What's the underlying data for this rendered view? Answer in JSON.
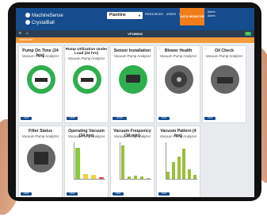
{
  "header": {
    "brand_primary": "MachineSense",
    "brand_secondary": "CrystalBall",
    "site_select": "Plantline",
    "nav": [
      "RESOURCES",
      "USERS",
      "MACHINES"
    ],
    "data_button": "DATA MONITOR",
    "user_line1": "Admin",
    "user_line2": "Admin"
  },
  "toolbar": {
    "title": "VP280843",
    "badge": "ON",
    "breadcrumb": "Dashboard"
  },
  "cards": [
    {
      "title": "Pump On Time (24 hrs)",
      "subtitle": "Vacuum Pump Analyzer",
      "button": "VIEW MORE"
    },
    {
      "title": "Pump Utilization Under Load (24 hrs)",
      "subtitle": "Vacuum Pump Analyzer",
      "button": "VIEW MORE"
    },
    {
      "title": "Sensor Installation",
      "subtitle": "Vacuum Pump Analyzer",
      "button": "MORE DETAILS"
    },
    {
      "title": "Blower Health",
      "subtitle": "Vacuum Pump Analyzer",
      "button": "VIEW MORE"
    },
    {
      "title": "Oil Check",
      "subtitle": "Vacuum Pump Analyzer",
      "button": "VIEW MORE"
    },
    {
      "title": "Filter Status",
      "subtitle": "Vacuum Pump Analyzer",
      "button": "VIEW MORE"
    },
    {
      "title": "Operating Vacuum (24 hrs)",
      "subtitle": "Vacuum Pump Analyzer",
      "button": "VIEW MORE"
    },
    {
      "title": "Vacuum Frequency (10 min)",
      "subtitle": "Vacuum Pump Analyzer",
      "button": "VIEW MORE"
    },
    {
      "title": "Vacuum Pattern (4 hrs)",
      "subtitle": "Vacuum Pump Analyzer",
      "button": "VIEW MORE"
    }
  ],
  "colors": {
    "header": "#154c8e",
    "accent_orange": "#f07d1a",
    "status_green": "#2fae4e",
    "chart_green": "#8dc63f",
    "chart_yellow": "#f4d03f",
    "chart_red": "#e74c3c",
    "chart_olive": "#9bbf3a"
  },
  "icons": [
    "machinesense-logo-icon",
    "menu-icon",
    "home-icon",
    "gauge-icon",
    "sensor-icon",
    "fan-icon",
    "oil-can-icon",
    "filter-icon"
  ],
  "chart_data": [
    {
      "type": "bar",
      "title": "Operating Vacuum (24 hrs)",
      "categories": [
        "",
        "",
        "",
        ""
      ],
      "values": [
        85,
        14,
        11,
        5
      ],
      "colors": [
        "#8dc63f",
        "#f4d03f",
        "#f4d03f",
        "#e74c3c"
      ],
      "ylim": [
        0,
        100
      ]
    },
    {
      "type": "bar",
      "title": "Vacuum Frequency (10 min)",
      "categories": [
        "",
        "",
        "",
        "",
        ""
      ],
      "values": [
        92,
        7,
        9,
        6,
        3
      ],
      "colors": [
        "#9bbf3a",
        "#9bbf3a",
        "#9bbf3a",
        "#9bbf3a",
        "#9bbf3a"
      ],
      "ylim": [
        0,
        100
      ]
    },
    {
      "type": "bar",
      "title": "Vacuum Pattern (4 hrs)",
      "categories": [
        "",
        "",
        "",
        "",
        "",
        ""
      ],
      "values": [
        6,
        14,
        18,
        25,
        8,
        3
      ],
      "colors": [
        "#9bbf3a",
        "#9bbf3a",
        "#9bbf3a",
        "#9bbf3a",
        "#9bbf3a",
        "#9bbf3a"
      ],
      "ylim": [
        0,
        30
      ]
    }
  ]
}
